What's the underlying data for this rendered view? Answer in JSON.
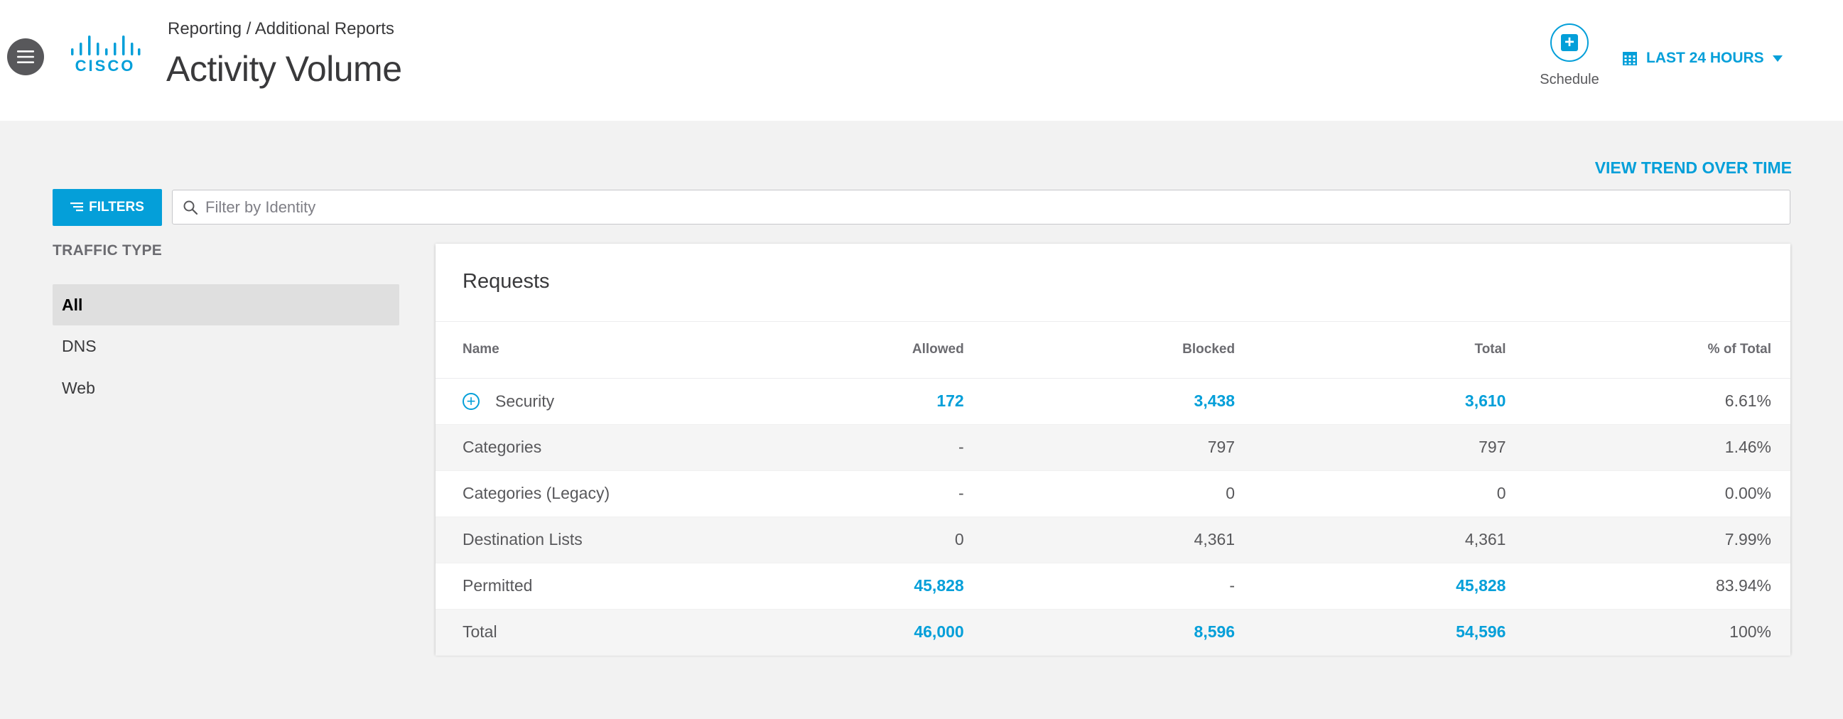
{
  "header": {
    "breadcrumb": "Reporting / Additional Reports",
    "title": "Activity Volume",
    "logo_text": "CISCO",
    "schedule_label": "Schedule",
    "date_range": "LAST 24 HOURS",
    "icons": [
      "menu-icon",
      "calendar-icon",
      "chevron-down-icon",
      "plus-icon"
    ]
  },
  "toolbar": {
    "trend_link": "VIEW TREND OVER TIME",
    "filters_label": "FILTERS",
    "search_placeholder": "Filter by Identity",
    "search_value": ""
  },
  "sidebar": {
    "heading": "TRAFFIC TYPE",
    "items": [
      {
        "label": "All",
        "selected": true
      },
      {
        "label": "DNS",
        "selected": false
      },
      {
        "label": "Web",
        "selected": false
      }
    ]
  },
  "requests": {
    "title": "Requests",
    "columns": [
      "Name",
      "Allowed",
      "Blocked",
      "Total",
      "% of Total"
    ],
    "rows": [
      {
        "name": "Security",
        "allowed": "172",
        "blocked": "3,438",
        "total": "3,610",
        "percent": "6.61%"
      },
      {
        "name": "Categories",
        "allowed": "-",
        "blocked": "797",
        "total": "797",
        "percent": "1.46%"
      },
      {
        "name": "Categories (Legacy)",
        "allowed": "-",
        "blocked": "0",
        "total": "0",
        "percent": "0.00%"
      },
      {
        "name": "Destination Lists",
        "allowed": "0",
        "blocked": "4,361",
        "total": "4,361",
        "percent": "7.99%"
      },
      {
        "name": "Permitted",
        "allowed": "45,828",
        "blocked": "-",
        "total": "45,828",
        "percent": "83.94%"
      },
      {
        "name": "Total",
        "allowed": "46,000",
        "blocked": "8,596",
        "total": "54,596",
        "percent": "100%"
      }
    ]
  },
  "colors": {
    "accent": "#049fd9",
    "header_bg": "#ffffff",
    "page_bg": "#f2f2f2",
    "selected_bg": "#dfdfdf"
  }
}
